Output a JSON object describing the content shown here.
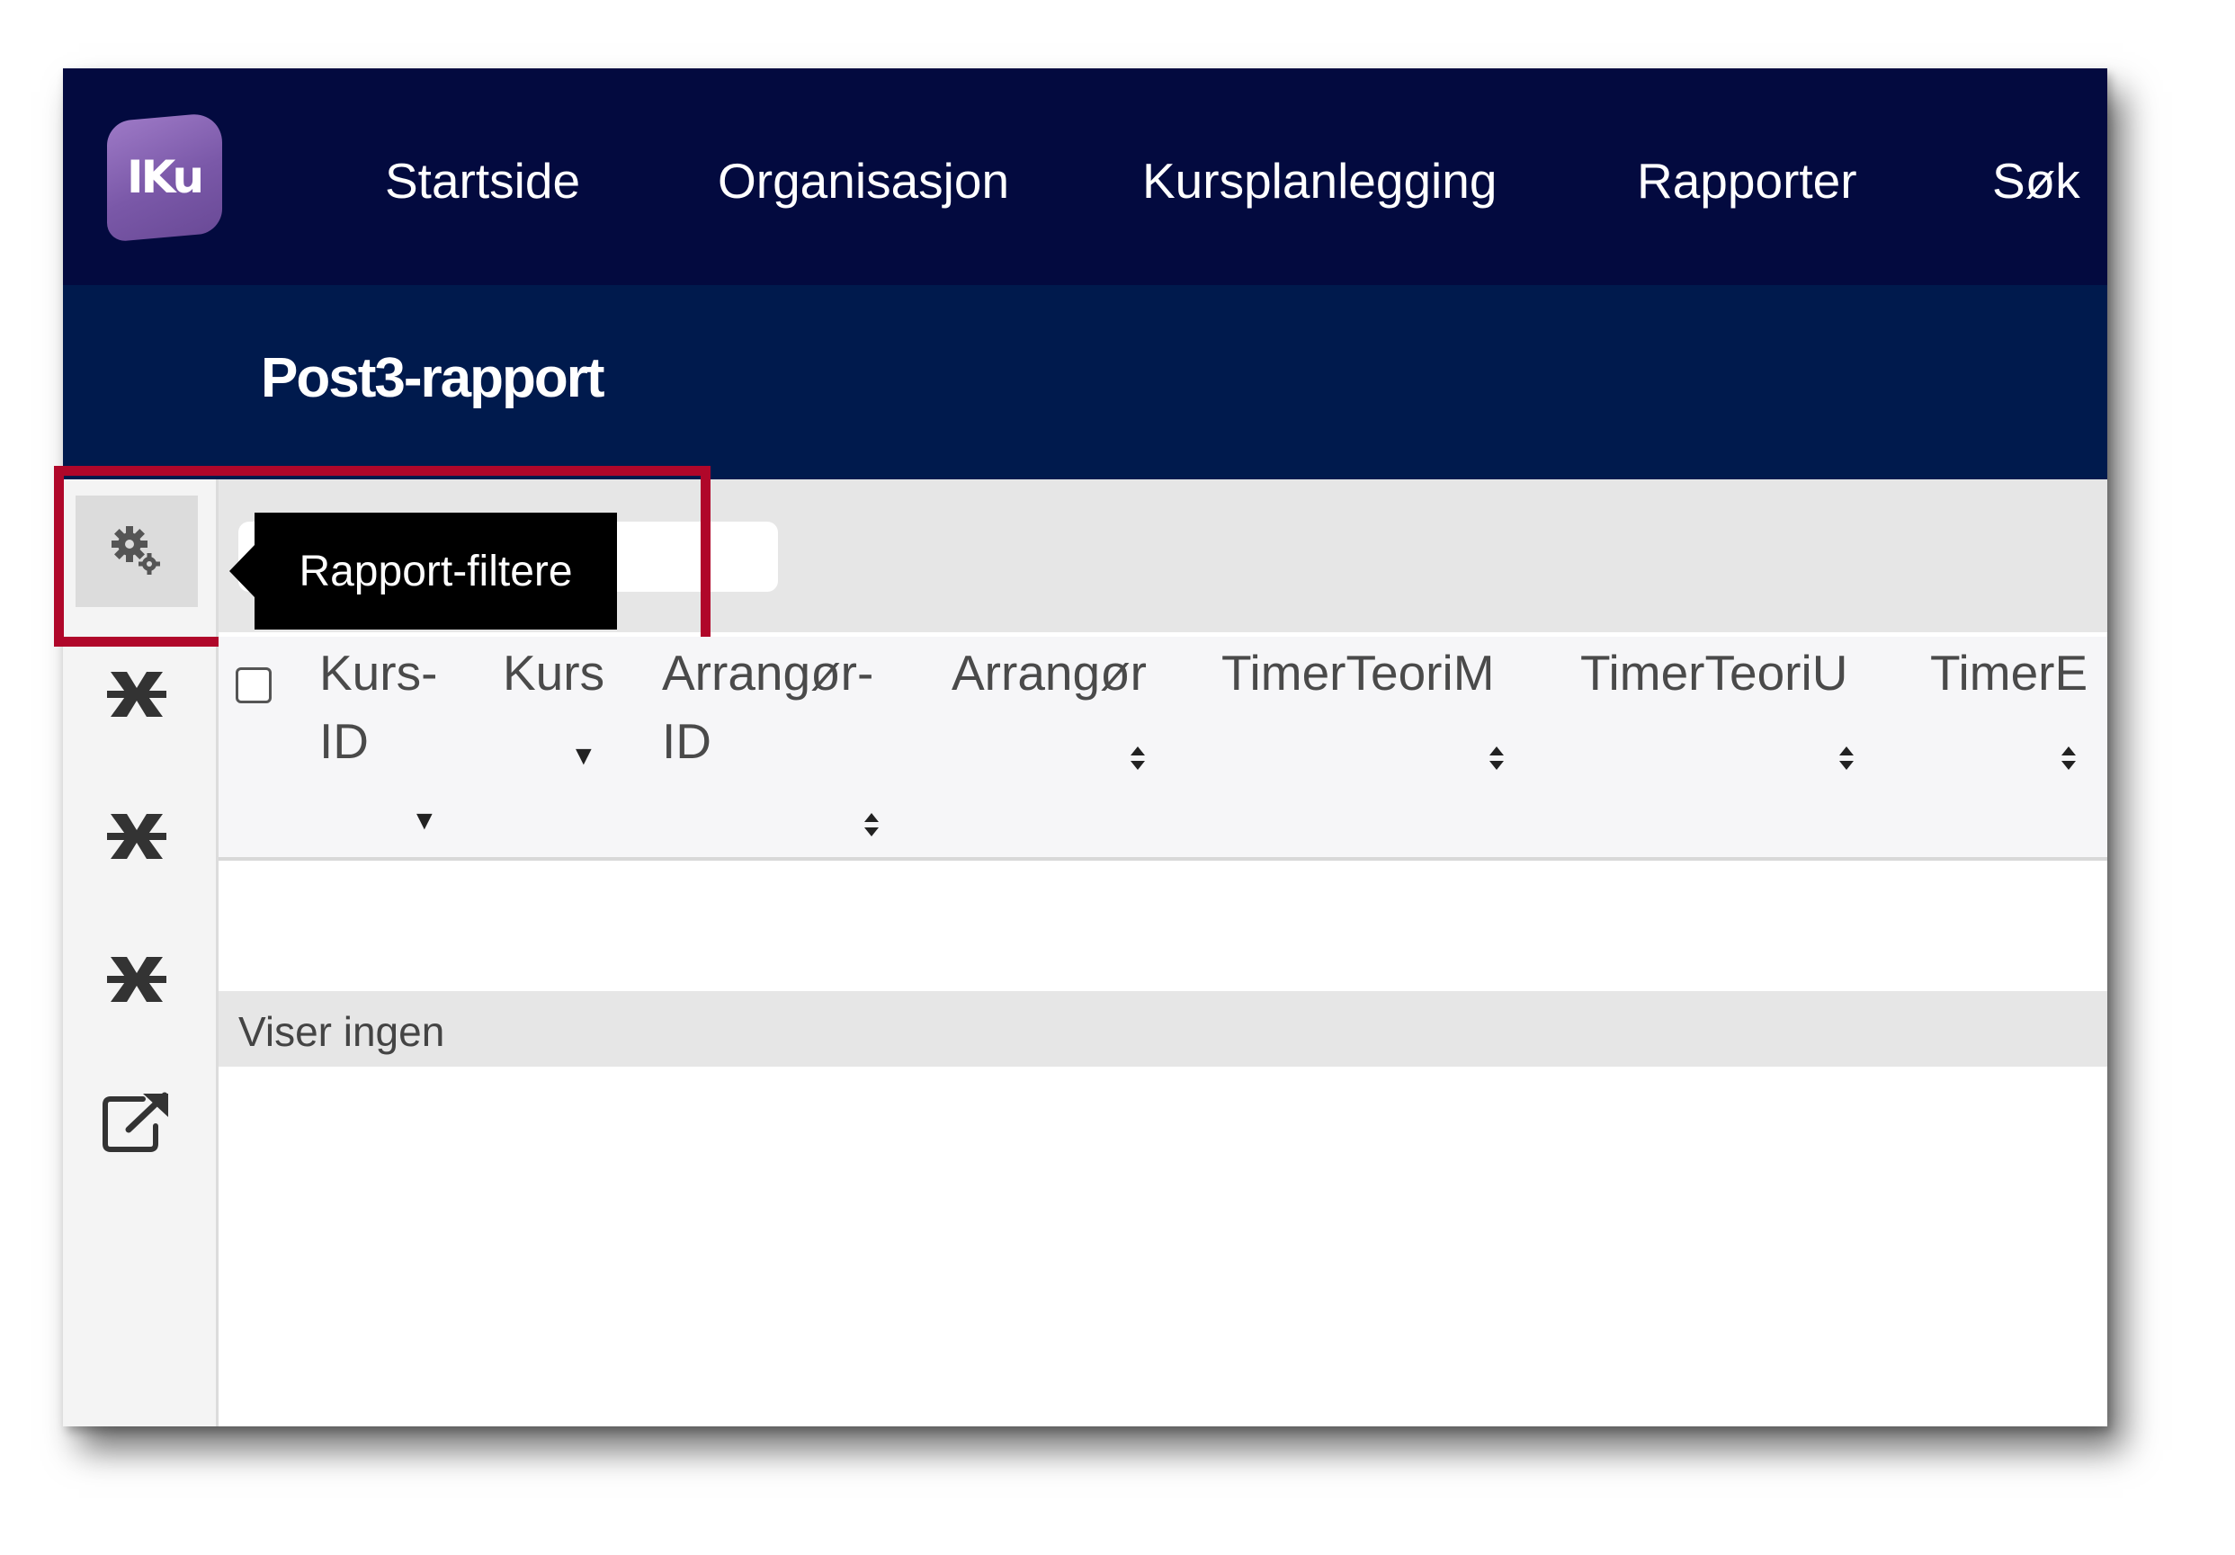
{
  "nav": {
    "logo_text": "IKu",
    "items": [
      "Startside",
      "Organisasjon",
      "Kursplanlegging",
      "Rapporter",
      "Søk"
    ]
  },
  "header": {
    "title": "Post3-rapport"
  },
  "sidebar": {
    "icons": [
      "gears-icon",
      "excel-export-icon",
      "excel-export-icon",
      "excel-export-icon",
      "external-link-icon"
    ]
  },
  "tooltip": {
    "text": "Rapport-filtere"
  },
  "table": {
    "columns": [
      {
        "line1": "Kurs-",
        "line2": "ID",
        "sort": "desc"
      },
      {
        "line1": "Kurs",
        "line2": "",
        "sort": "desc"
      },
      {
        "line1": "Arrangør-",
        "line2": "ID",
        "sort": "both"
      },
      {
        "line1": "Arrangør",
        "line2": "",
        "sort": "both"
      },
      {
        "line1": "TimerTeoriM",
        "line2": "",
        "sort": "both"
      },
      {
        "line1": "TimerTeoriU",
        "line2": "",
        "sort": "both"
      },
      {
        "line1": "TimerE",
        "line2": "",
        "sort": "both"
      }
    ],
    "info": "Viser ingen"
  },
  "colors": {
    "topnav": "#030a3f",
    "subheader": "#001a4d",
    "highlight": "#b0072a",
    "logo": "#8a66b6"
  }
}
